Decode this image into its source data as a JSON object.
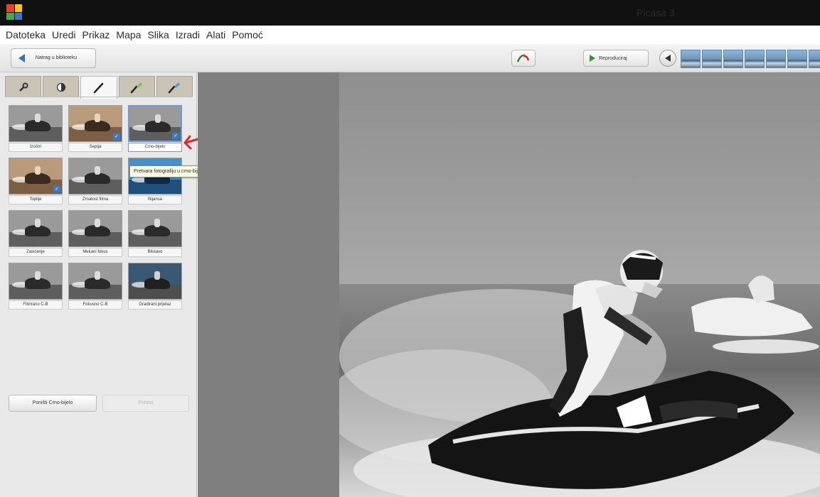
{
  "window": {
    "title": "Picasa 3"
  },
  "menu": [
    "Datoteka",
    "Uredi",
    "Prikaz",
    "Mapa",
    "Slika",
    "Izradi",
    "Alati",
    "Pomoć"
  ],
  "toolbar": {
    "back_label": "Natrag u biblioteku",
    "play_label": "Reproduciraj",
    "redeye_icon": "redeye-icon",
    "filmstrip_count": 7
  },
  "sidebar": {
    "tabs": [
      {
        "icon": "wrench-icon"
      },
      {
        "icon": "contrast-icon"
      },
      {
        "icon": "brush-icon",
        "active": true
      },
      {
        "icon": "green-brush-icon"
      },
      {
        "icon": "blue-brush-icon"
      }
    ],
    "effects": [
      {
        "label": "Izoštri",
        "style": "gray",
        "applied": false
      },
      {
        "label": "Sepija",
        "style": "sepia",
        "applied": true
      },
      {
        "label": "Crno-bijelo",
        "style": "gray",
        "applied": true,
        "selected": true
      },
      {
        "label": "Toplije",
        "style": "sepia",
        "applied": true
      },
      {
        "label": "Zrnatost filma",
        "style": "gray",
        "applied": false
      },
      {
        "label": "Nijansa",
        "style": "blue",
        "applied": false
      },
      {
        "label": "Zasićenje",
        "style": "gray",
        "applied": false
      },
      {
        "label": "Mekani fokus",
        "style": "gray",
        "applied": false
      },
      {
        "label": "Blistavo",
        "style": "gray",
        "applied": false
      },
      {
        "label": "Filtrirano C-B",
        "style": "gray",
        "applied": false
      },
      {
        "label": "Fokusno C-B",
        "style": "gray",
        "applied": false
      },
      {
        "label": "Gradirani prijelaz",
        "style": "darkblue",
        "applied": false
      }
    ],
    "tooltip": "Pretvara fotografiju u crno-bijelu",
    "apply_label": "Poništi Crno-bijelo",
    "reset_label": "Ponovi"
  },
  "colors": {
    "accent": "#3b79c8",
    "annotation": "#e3242b",
    "canvas_bg": "#7f7f7f",
    "tab_inactive": "#c9c4b6"
  }
}
